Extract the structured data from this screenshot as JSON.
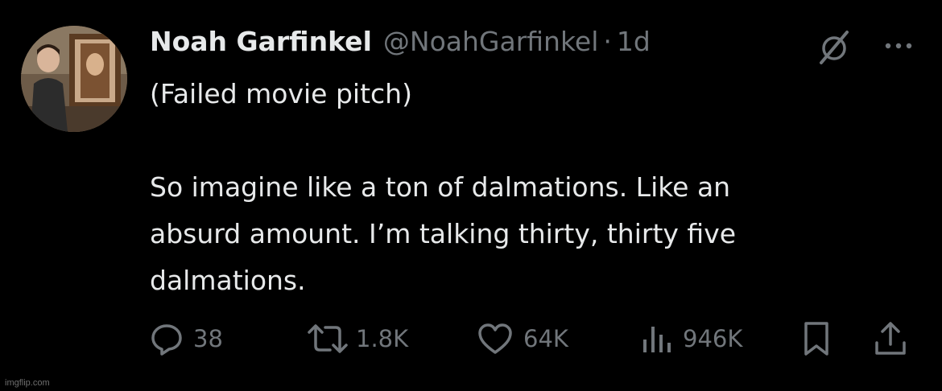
{
  "author": {
    "name": "Noah Garfinkel",
    "handle": "@NoahGarfinkel",
    "separator": "·",
    "time": "1d"
  },
  "tweet": {
    "lines": [
      "(Failed movie pitch)",
      "So imagine like a ton of dalmations. Like an",
      "absurd amount. I’m talking thirty, thirty five",
      "dalmations."
    ]
  },
  "actions": {
    "replies": "38",
    "reposts": "1.8K",
    "likes": "64K",
    "views": "946K"
  },
  "icons": [
    "grok-icon",
    "more-icon",
    "reply-icon",
    "repost-icon",
    "like-icon",
    "views-icon",
    "bookmark-icon",
    "share-icon"
  ],
  "colors": {
    "background": "#000000",
    "text": "#e7e9ea",
    "muted": "#71767b"
  },
  "watermark": "imgflip.com"
}
